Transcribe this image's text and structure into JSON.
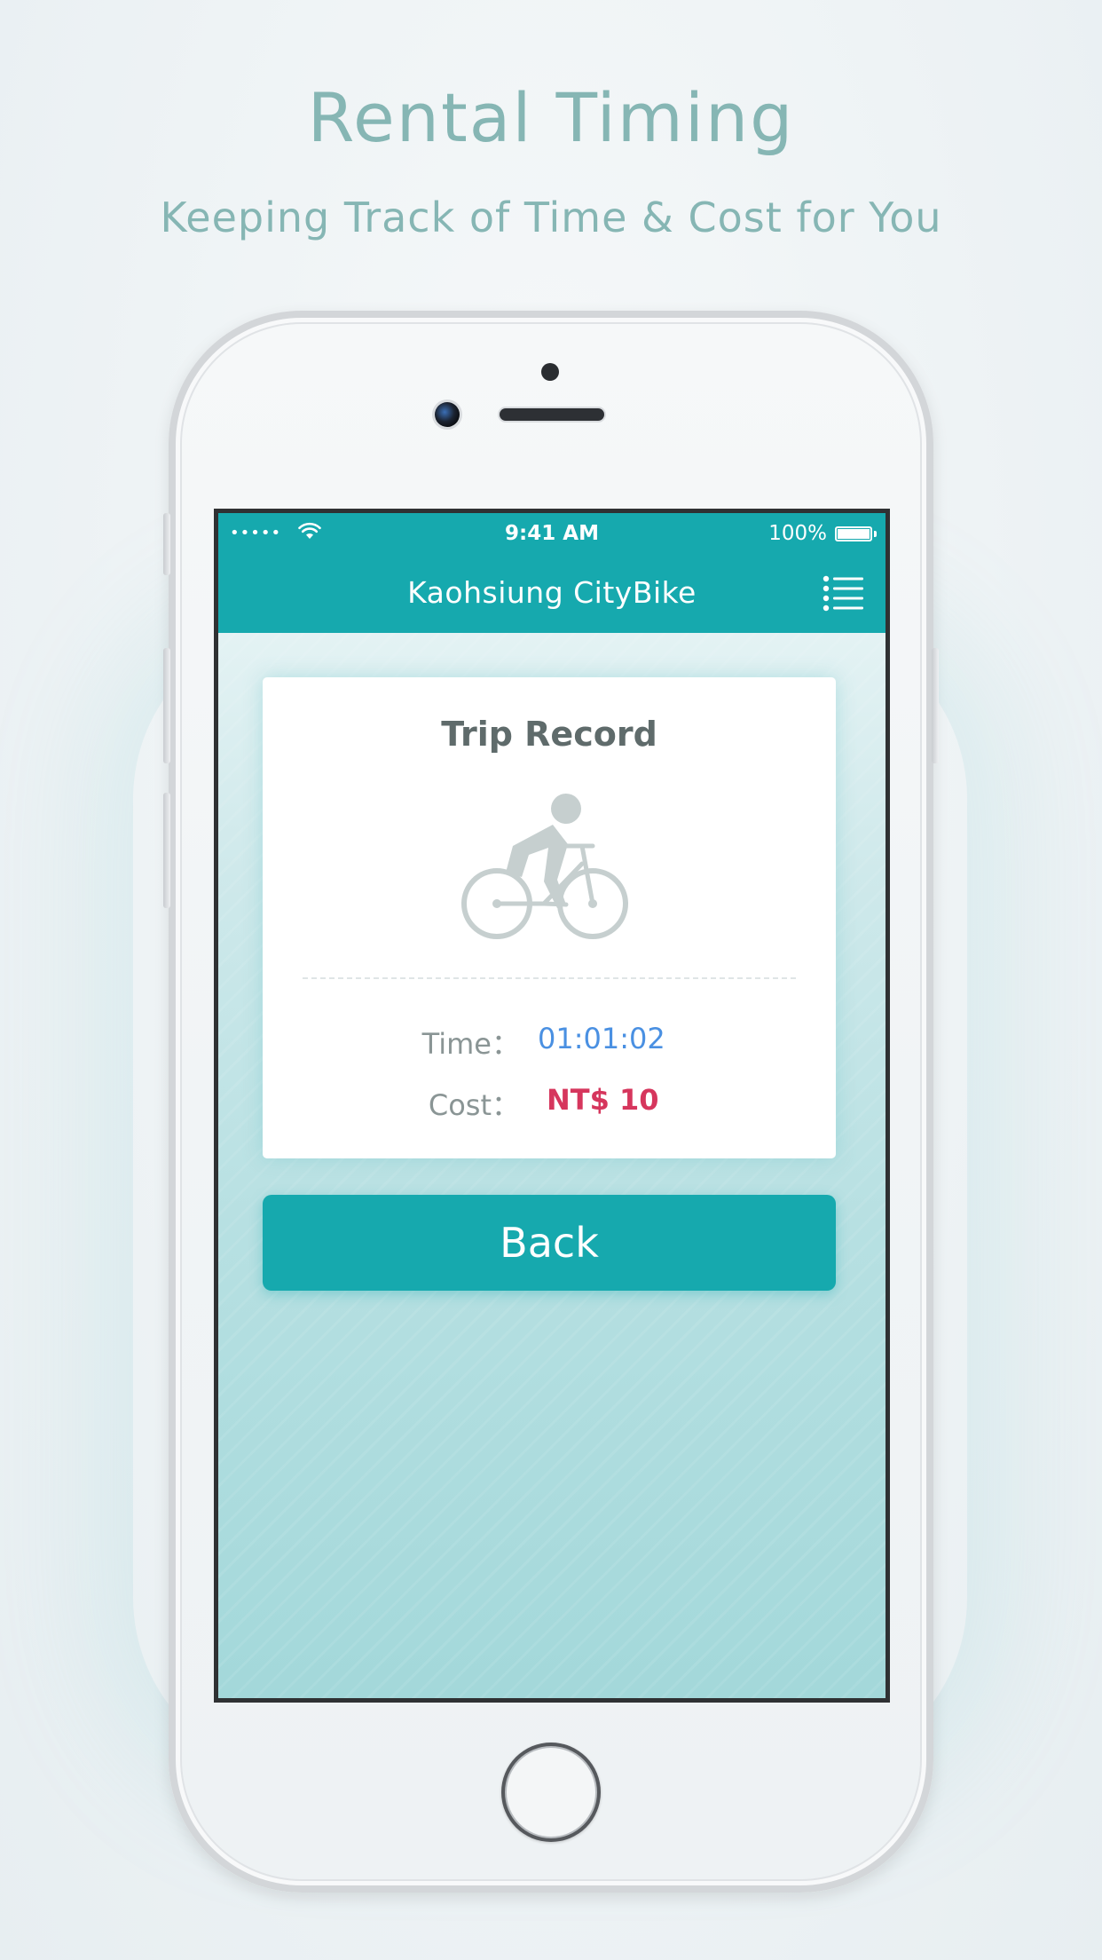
{
  "promo": {
    "title": "Rental Timing",
    "subtitle": "Keeping Track of Time & Cost for You"
  },
  "status_bar": {
    "signal": "•••••",
    "time": "9:41 AM",
    "battery": "100%"
  },
  "nav": {
    "title": "Kaohsiung CityBike",
    "menu_icon": "list-menu-icon"
  },
  "trip_record": {
    "title": "Trip Record",
    "icon": "cyclist-icon",
    "time_label": "Time：",
    "time_value": "01:01:02",
    "cost_label": "Cost：",
    "cost_value": "NT$ 10"
  },
  "actions": {
    "back_label": "Back"
  },
  "colors": {
    "brand": "#16a9ae",
    "promo_text": "#86b6b4",
    "time_value": "#4a90e2",
    "cost_value": "#d6365d"
  }
}
